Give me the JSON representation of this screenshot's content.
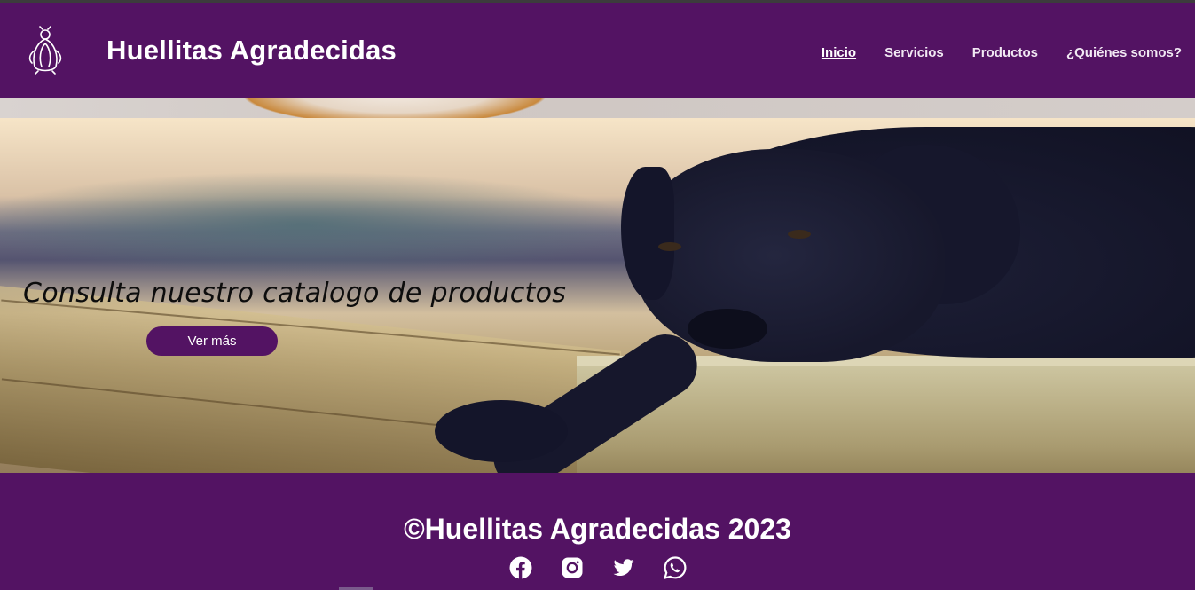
{
  "header": {
    "brand": "Huellitas Agradecidas",
    "logo_icon": "penguin-logo-icon",
    "nav": [
      {
        "label": "Inicio",
        "active": true
      },
      {
        "label": "Servicios",
        "active": false
      },
      {
        "label": "Productos",
        "active": false
      },
      {
        "label": "¿Quiénes somos?",
        "active": false
      }
    ]
  },
  "hero": {
    "title": "Consulta nuestro catalogo de productos",
    "button_label": "Ver más",
    "image_subject": "black-labrador-lying-on-wooden-plank"
  },
  "footer": {
    "copyright": "©Huellitas Agradecidas 2023",
    "social_icons": [
      "facebook-icon",
      "instagram-icon",
      "twitter-icon",
      "whatsapp-icon"
    ]
  },
  "colors": {
    "brand_purple": "#531363",
    "text_white": "#ffffff"
  }
}
